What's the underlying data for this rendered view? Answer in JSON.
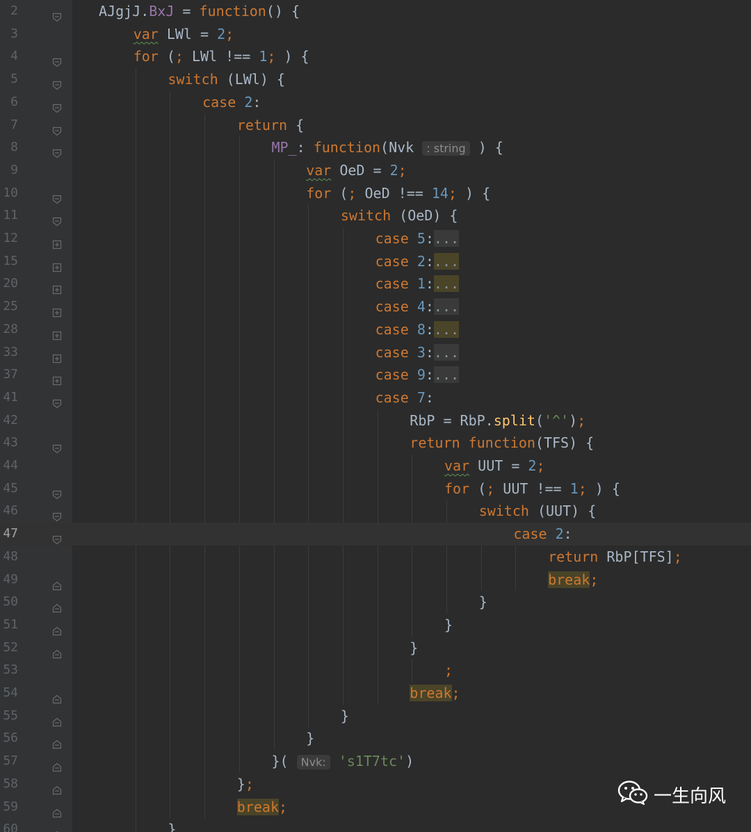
{
  "editor": {
    "current_line": "47",
    "param_hint": ": string",
    "arg_hint": "Nvk:",
    "fold_placeholder": "...",
    "lines": [
      {
        "ln": "2",
        "indent": 0,
        "fold": "open",
        "tokens": [
          [
            "id",
            "AJgjJ"
          ],
          [
            "id",
            "."
          ],
          [
            "prop",
            "BxJ"
          ],
          [
            "id",
            " = "
          ],
          [
            "kw",
            "function"
          ],
          [
            "id",
            "() {"
          ]
        ]
      },
      {
        "ln": "3",
        "indent": 1,
        "fold": "none",
        "tokens": [
          [
            "sq",
            "var"
          ],
          [
            "id",
            " LWl = "
          ],
          [
            "num",
            "2"
          ],
          [
            "kw",
            ";"
          ]
        ]
      },
      {
        "ln": "4",
        "indent": 1,
        "fold": "open",
        "tokens": [
          [
            "kw",
            "for"
          ],
          [
            "id",
            " ("
          ],
          [
            "kw",
            ";"
          ],
          [
            "id",
            " LWl !== "
          ],
          [
            "num",
            "1"
          ],
          [
            "kw",
            ";"
          ],
          [
            "id",
            " ) {"
          ]
        ]
      },
      {
        "ln": "5",
        "indent": 2,
        "fold": "open",
        "tokens": [
          [
            "kw",
            "switch"
          ],
          [
            "id",
            " (LWl) {"
          ]
        ]
      },
      {
        "ln": "6",
        "indent": 3,
        "fold": "open",
        "tokens": [
          [
            "kw",
            "case "
          ],
          [
            "num",
            "2"
          ],
          [
            "id",
            ":"
          ]
        ]
      },
      {
        "ln": "7",
        "indent": 4,
        "fold": "open",
        "tokens": [
          [
            "kw",
            "return"
          ],
          [
            "id",
            " {"
          ]
        ]
      },
      {
        "ln": "8",
        "indent": 5,
        "fold": "open",
        "tokens": [
          [
            "prop",
            "MP_"
          ],
          [
            "id",
            ": "
          ],
          [
            "kw",
            "function"
          ],
          [
            "id",
            "(Nvk "
          ],
          [
            "hint_param",
            ""
          ],
          [
            "id",
            " ) {"
          ]
        ]
      },
      {
        "ln": "9",
        "indent": 6,
        "fold": "none",
        "tokens": [
          [
            "sq",
            "var"
          ],
          [
            "id",
            " OeD = "
          ],
          [
            "num",
            "2"
          ],
          [
            "kw",
            ";"
          ]
        ]
      },
      {
        "ln": "10",
        "indent": 6,
        "fold": "open",
        "tokens": [
          [
            "kw",
            "for"
          ],
          [
            "id",
            " ("
          ],
          [
            "kw",
            ";"
          ],
          [
            "id",
            " OeD !== "
          ],
          [
            "num",
            "14"
          ],
          [
            "kw",
            ";"
          ],
          [
            "id",
            " ) {"
          ]
        ]
      },
      {
        "ln": "11",
        "indent": 7,
        "fold": "open",
        "tokens": [
          [
            "kw",
            "switch"
          ],
          [
            "id",
            " (OeD) {"
          ]
        ]
      },
      {
        "ln": "12",
        "indent": 8,
        "fold": "closed",
        "tokens": [
          [
            "kw",
            "case "
          ],
          [
            "num",
            "5"
          ],
          [
            "id",
            ":"
          ],
          [
            "fold_dots",
            ""
          ]
        ]
      },
      {
        "ln": "15",
        "indent": 8,
        "fold": "closed",
        "tokens": [
          [
            "kw",
            "case "
          ],
          [
            "num",
            "2"
          ],
          [
            "id",
            ":"
          ],
          [
            "fold_dots_match",
            ""
          ]
        ]
      },
      {
        "ln": "20",
        "indent": 8,
        "fold": "closed",
        "tokens": [
          [
            "kw",
            "case "
          ],
          [
            "num",
            "1"
          ],
          [
            "id",
            ":"
          ],
          [
            "fold_dots_match",
            ""
          ]
        ]
      },
      {
        "ln": "25",
        "indent": 8,
        "fold": "closed",
        "tokens": [
          [
            "kw",
            "case "
          ],
          [
            "num",
            "4"
          ],
          [
            "id",
            ":"
          ],
          [
            "fold_dots",
            ""
          ]
        ]
      },
      {
        "ln": "28",
        "indent": 8,
        "fold": "closed",
        "tokens": [
          [
            "kw",
            "case "
          ],
          [
            "num",
            "8"
          ],
          [
            "id",
            ":"
          ],
          [
            "fold_dots_match",
            ""
          ]
        ]
      },
      {
        "ln": "33",
        "indent": 8,
        "fold": "closed",
        "tokens": [
          [
            "kw",
            "case "
          ],
          [
            "num",
            "3"
          ],
          [
            "id",
            ":"
          ],
          [
            "fold_dots",
            ""
          ]
        ]
      },
      {
        "ln": "37",
        "indent": 8,
        "fold": "closed",
        "tokens": [
          [
            "kw",
            "case "
          ],
          [
            "num",
            "9"
          ],
          [
            "id",
            ":"
          ],
          [
            "fold_dots",
            ""
          ]
        ]
      },
      {
        "ln": "41",
        "indent": 8,
        "fold": "open",
        "tokens": [
          [
            "kw",
            "case "
          ],
          [
            "num",
            "7"
          ],
          [
            "id",
            ":"
          ]
        ]
      },
      {
        "ln": "42",
        "indent": 9,
        "fold": "none",
        "tokens": [
          [
            "id",
            "RbP = RbP."
          ],
          [
            "fn",
            "split"
          ],
          [
            "id",
            "("
          ],
          [
            "str",
            "'^'"
          ],
          [
            "id",
            ")"
          ],
          [
            "kw",
            ";"
          ]
        ]
      },
      {
        "ln": "43",
        "indent": 9,
        "fold": "open",
        "tokens": [
          [
            "kw",
            "return function"
          ],
          [
            "id",
            "(TFS) {"
          ]
        ]
      },
      {
        "ln": "44",
        "indent": 10,
        "fold": "none",
        "tokens": [
          [
            "sq",
            "var"
          ],
          [
            "id",
            " UUT = "
          ],
          [
            "num",
            "2"
          ],
          [
            "kw",
            ";"
          ]
        ]
      },
      {
        "ln": "45",
        "indent": 10,
        "fold": "open",
        "tokens": [
          [
            "kw",
            "for"
          ],
          [
            "id",
            " ("
          ],
          [
            "kw",
            ";"
          ],
          [
            "id",
            " UUT !== "
          ],
          [
            "num",
            "1"
          ],
          [
            "kw",
            ";"
          ],
          [
            "id",
            " ) {"
          ]
        ]
      },
      {
        "ln": "46",
        "indent": 11,
        "fold": "open",
        "tokens": [
          [
            "kw",
            "switch"
          ],
          [
            "id",
            " (UUT) {"
          ]
        ]
      },
      {
        "ln": "47",
        "indent": 12,
        "fold": "open",
        "tokens": [
          [
            "kw",
            "case "
          ],
          [
            "num",
            "2"
          ],
          [
            "id",
            ":"
          ]
        ]
      },
      {
        "ln": "48",
        "indent": 13,
        "fold": "none",
        "tokens": [
          [
            "kw",
            "return"
          ],
          [
            "id",
            " RbP[TFS]"
          ],
          [
            "kw",
            ";"
          ]
        ]
      },
      {
        "ln": "49",
        "indent": 13,
        "fold": "end",
        "tokens": [
          [
            "break",
            "break"
          ],
          [
            "kw",
            ";"
          ]
        ]
      },
      {
        "ln": "50",
        "indent": 11,
        "fold": "end",
        "tokens": [
          [
            "id",
            "}"
          ]
        ]
      },
      {
        "ln": "51",
        "indent": 10,
        "fold": "end",
        "tokens": [
          [
            "id",
            "}"
          ]
        ]
      },
      {
        "ln": "52",
        "indent": 9,
        "fold": "end",
        "tokens": [
          [
            "id",
            "}"
          ]
        ]
      },
      {
        "ln": "53",
        "indent": 10,
        "fold": "none",
        "tokens": [
          [
            "kw",
            ";"
          ]
        ]
      },
      {
        "ln": "54",
        "indent": 9,
        "fold": "end",
        "tokens": [
          [
            "break",
            "break"
          ],
          [
            "kw",
            ";"
          ]
        ]
      },
      {
        "ln": "55",
        "indent": 7,
        "fold": "end",
        "tokens": [
          [
            "id",
            "}"
          ]
        ]
      },
      {
        "ln": "56",
        "indent": 6,
        "fold": "end",
        "tokens": [
          [
            "id",
            "}"
          ]
        ]
      },
      {
        "ln": "57",
        "indent": 5,
        "fold": "end",
        "tokens": [
          [
            "id",
            "}( "
          ],
          [
            "hint_arg",
            ""
          ],
          [
            "id",
            " "
          ],
          [
            "str",
            "'s1T7tc'"
          ],
          [
            "id",
            ")"
          ]
        ]
      },
      {
        "ln": "58",
        "indent": 4,
        "fold": "end",
        "tokens": [
          [
            "id",
            "}"
          ],
          [
            "kw",
            ";"
          ]
        ]
      },
      {
        "ln": "59",
        "indent": 4,
        "fold": "end",
        "tokens": [
          [
            "break",
            "break"
          ],
          [
            "kw",
            ";"
          ]
        ]
      },
      {
        "ln": "60",
        "indent": 2,
        "fold": "end",
        "tokens": [
          [
            "id",
            "}"
          ]
        ]
      }
    ]
  },
  "watermark": {
    "text": "一生向风",
    "icon": "wechat-icon"
  }
}
